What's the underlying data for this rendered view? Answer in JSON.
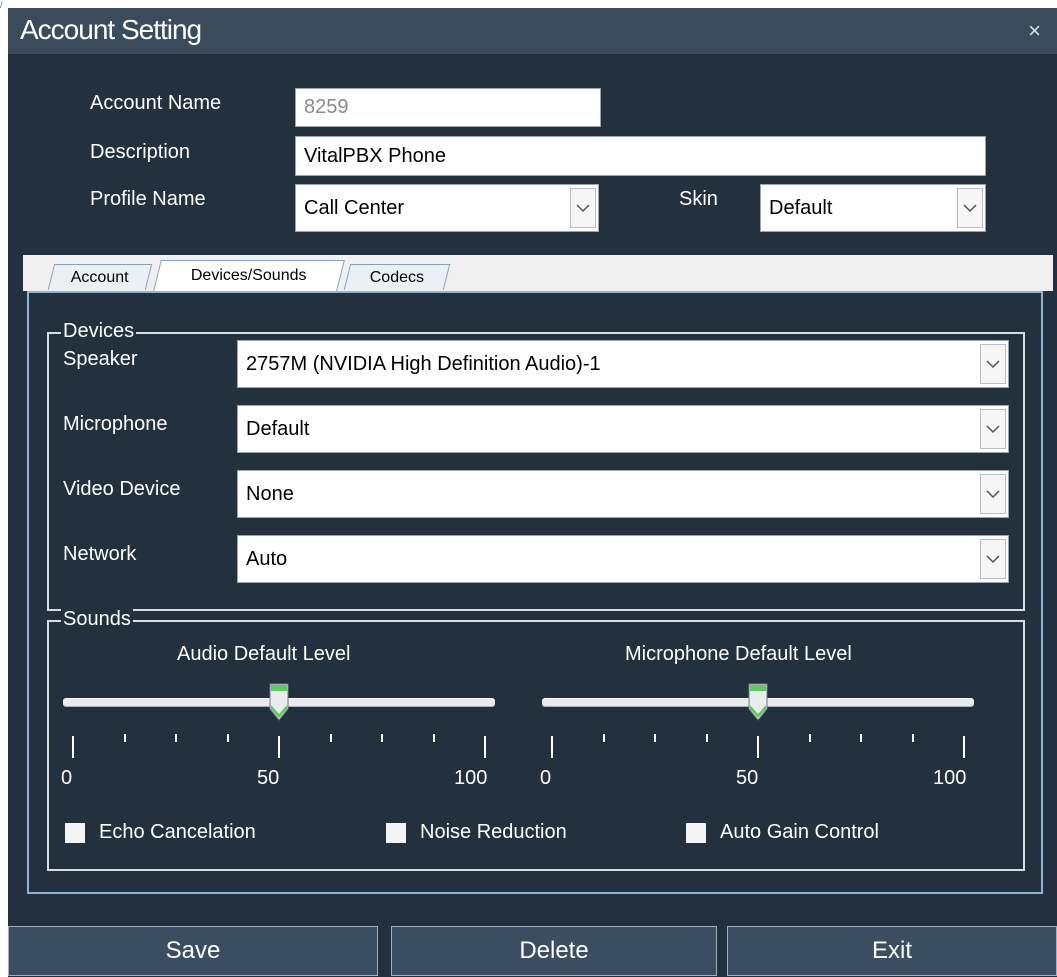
{
  "window": {
    "title": "Account Setting",
    "close_glyph": "×"
  },
  "corner_mark": "/",
  "form": {
    "account_name_label": "Account Name",
    "account_name_value": "8259",
    "description_label": "Description",
    "description_value": "VitalPBX Phone",
    "profile_label": "Profile Name",
    "profile_value": "Call Center",
    "skin_label": "Skin",
    "skin_value": "Default"
  },
  "tabs": [
    {
      "label": "Account",
      "active": false
    },
    {
      "label": "Devices/Sounds",
      "active": true
    },
    {
      "label": "Codecs",
      "active": false
    }
  ],
  "devices": {
    "title": "Devices",
    "speaker_label": "Speaker",
    "speaker_value": "2757M (NVIDIA High Definition Audio)-1",
    "microphone_label": "Microphone",
    "microphone_value": "Default",
    "video_label": "Video Device",
    "video_value": "None",
    "network_label": "Network",
    "network_value": "Auto"
  },
  "sounds": {
    "title": "Sounds",
    "audio_label": "Audio Default Level",
    "audio_level": 50,
    "mic_label": "Microphone Default Level",
    "mic_level": 50,
    "scale_min": "0",
    "scale_mid": "50",
    "scale_max": "100",
    "echo_label": "Echo Cancelation",
    "echo_checked": false,
    "noise_label": "Noise Reduction",
    "noise_checked": false,
    "agc_label": "Auto Gain Control",
    "agc_checked": false
  },
  "buttons": {
    "save": "Save",
    "delete": "Delete",
    "exit": "Exit"
  },
  "colors": {
    "window_bg": "#23303d",
    "titlebar": "#3a4b5c",
    "thumb_green": "#5cc95c",
    "panel_border": "#8fb3d2"
  },
  "icons": {
    "close": "close-icon",
    "dropdown": "chevron-down-icon",
    "slider_thumb": "slider-thumb-icon"
  }
}
